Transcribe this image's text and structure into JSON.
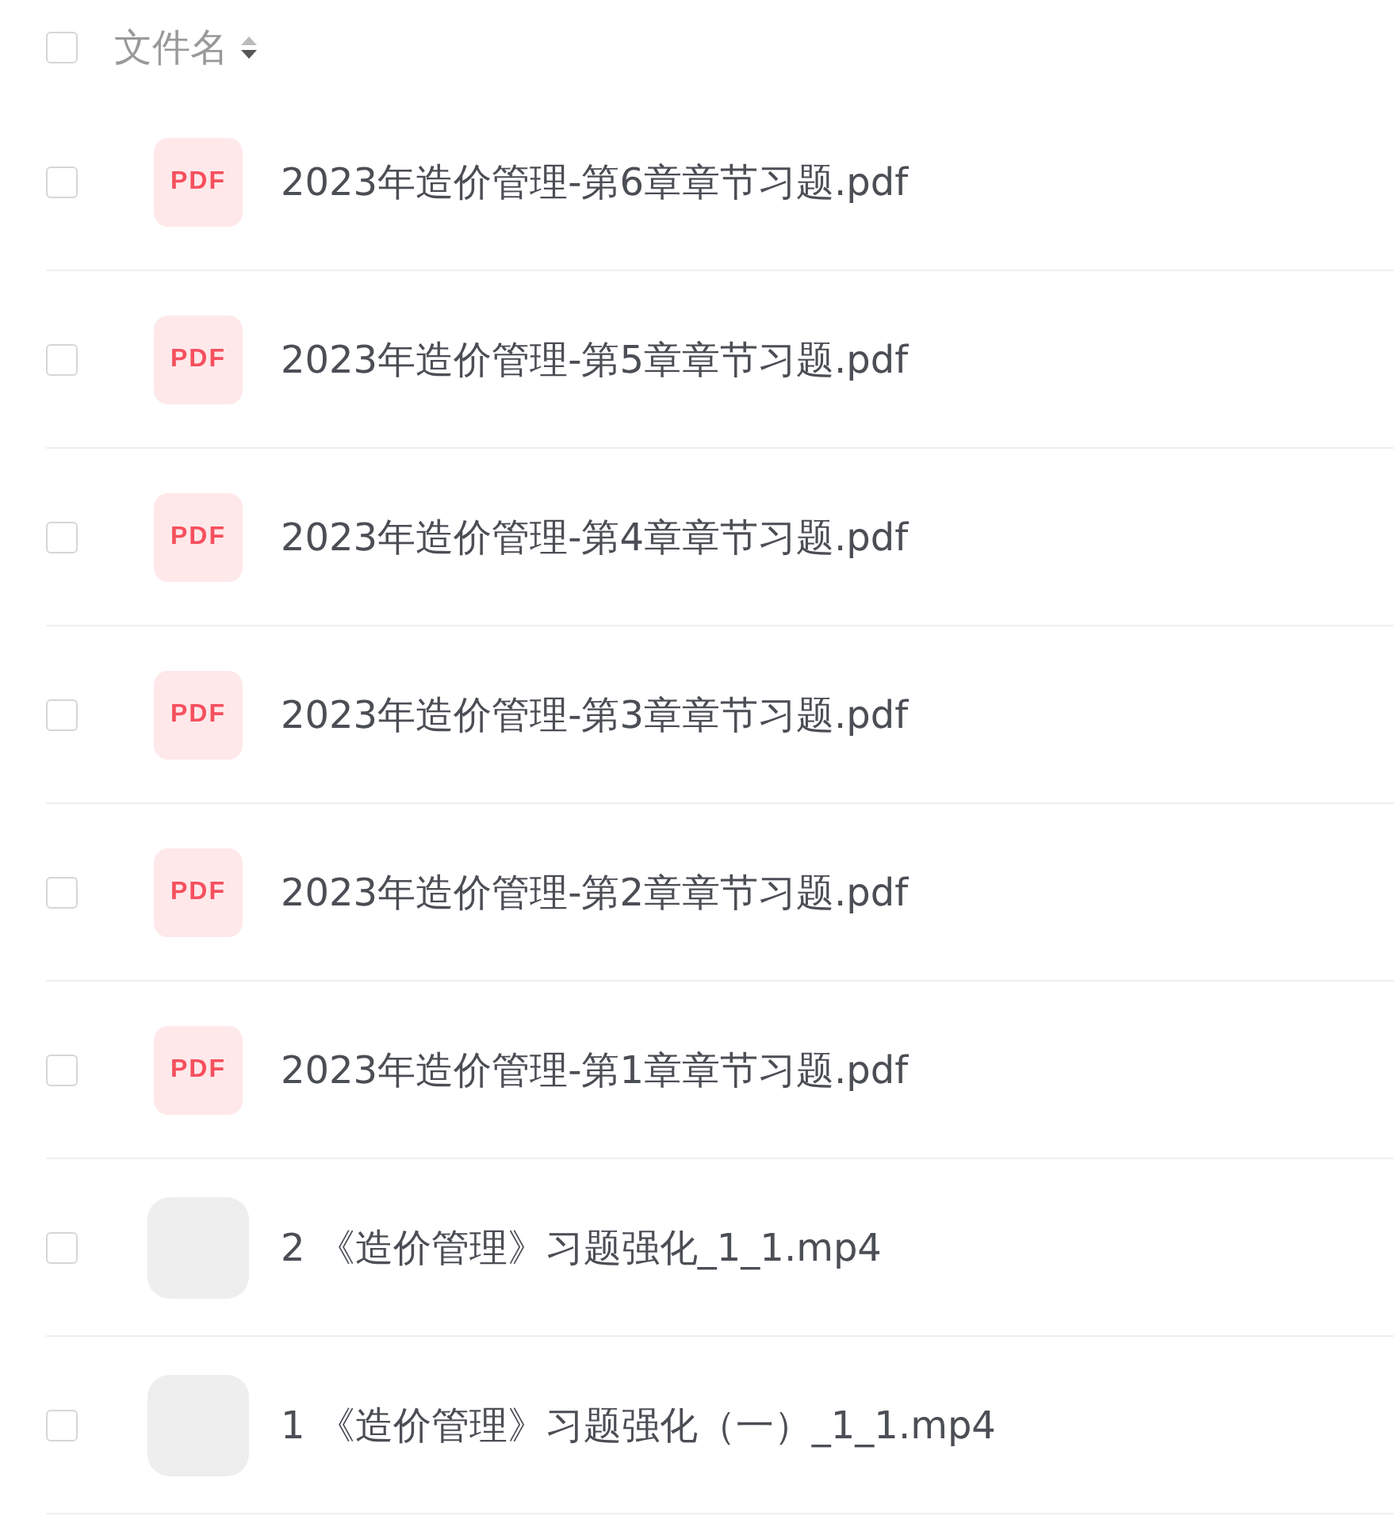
{
  "header": {
    "checked": false,
    "label": "文件名",
    "sort_descending": true
  },
  "files": [
    {
      "kind": "pdf",
      "badge": "PDF",
      "name": "2023年造价管理-第6章章节习题.pdf",
      "checked": false
    },
    {
      "kind": "pdf",
      "badge": "PDF",
      "name": "2023年造价管理-第5章章节习题.pdf",
      "checked": false
    },
    {
      "kind": "pdf",
      "badge": "PDF",
      "name": "2023年造价管理-第4章章节习题.pdf",
      "checked": false
    },
    {
      "kind": "pdf",
      "badge": "PDF",
      "name": "2023年造价管理-第3章章节习题.pdf",
      "checked": false
    },
    {
      "kind": "pdf",
      "badge": "PDF",
      "name": "2023年造价管理-第2章章节习题.pdf",
      "checked": false
    },
    {
      "kind": "pdf",
      "badge": "PDF",
      "name": "2023年造价管理-第1章章节习题.pdf",
      "checked": false
    },
    {
      "kind": "video",
      "name": "2 《造价管理》习题强化_1_1.mp4",
      "checked": false
    },
    {
      "kind": "video",
      "name": "1 《造价管理》习题强化（一）_1_1.mp4",
      "checked": false
    }
  ]
}
